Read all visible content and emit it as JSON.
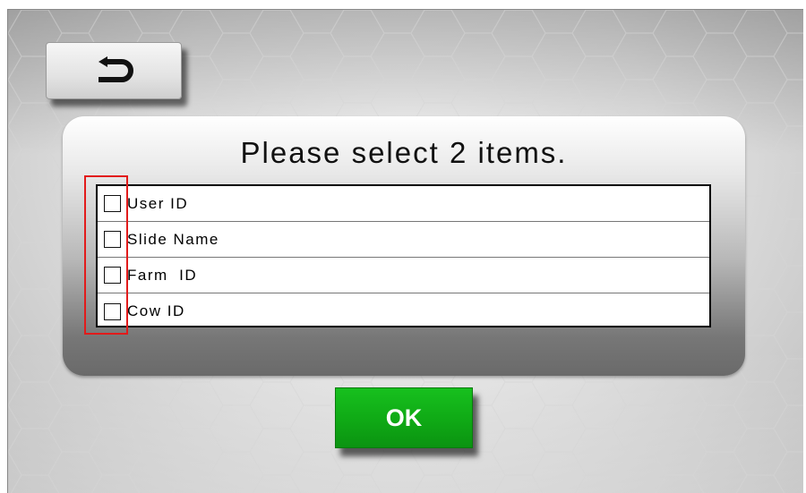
{
  "header": {
    "back_icon": "back-arrow-icon"
  },
  "dialog": {
    "title": "Please select 2 items.",
    "items": [
      {
        "label": "User ID",
        "checked": false
      },
      {
        "label": "Slide Name",
        "checked": false
      },
      {
        "label": "Farm  ID",
        "checked": false
      },
      {
        "label": "Cow ID",
        "checked": false
      }
    ]
  },
  "ok_button": {
    "label": "OK",
    "color": "#12b319"
  },
  "highlight": {
    "color": "#e21b1b"
  }
}
